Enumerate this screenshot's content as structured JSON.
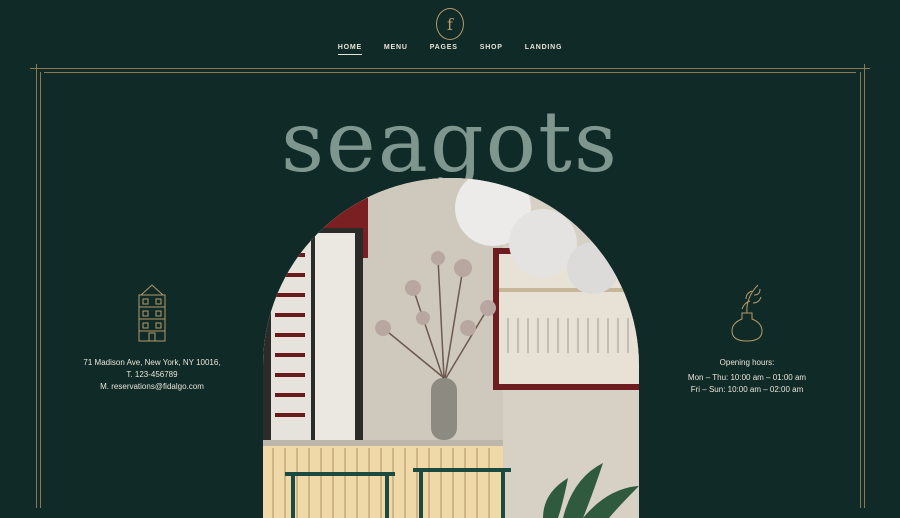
{
  "logo_letter": "f",
  "nav": [
    {
      "label": "HOME",
      "active": true
    },
    {
      "label": "MENU"
    },
    {
      "label": "PAGES"
    },
    {
      "label": "SHOP"
    },
    {
      "label": "LANDING"
    }
  ],
  "brand": "seagots",
  "contact": {
    "address": "71 Madison Ave, New York, NY 10016,",
    "phone": "T. 123-456789",
    "email": "M. reservations@fidalgo.com"
  },
  "hours": {
    "title": "Opening hours:",
    "line1": "Mon – Thu: 10:00 am – 01:00 am",
    "line2": "Fri – Sun: 10:00 am – 02:00 am"
  },
  "colors": {
    "background": "#0f2a27",
    "gold": "#b69a6a",
    "text": "#e9e4d6",
    "brand": "#7f968f"
  }
}
